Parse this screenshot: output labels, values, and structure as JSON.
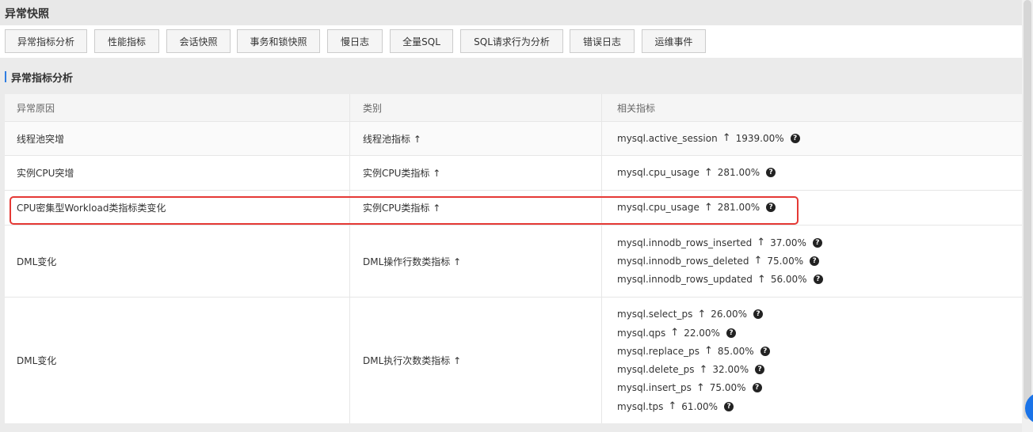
{
  "panel": {
    "title": "异常快照"
  },
  "tabs": [
    {
      "label": "异常指标分析"
    },
    {
      "label": "性能指标"
    },
    {
      "label": "会话快照"
    },
    {
      "label": "事务和锁快照"
    },
    {
      "label": "慢日志"
    },
    {
      "label": "全量SQL"
    },
    {
      "label": "SQL请求行为分析"
    },
    {
      "label": "错误日志"
    },
    {
      "label": "运维事件"
    }
  ],
  "section": {
    "title": "异常指标分析"
  },
  "table": {
    "columns": [
      "异常原因",
      "类别",
      "相关指标"
    ],
    "arrow": "↑",
    "rows": [
      {
        "reason": "线程池突增",
        "category": "线程池指标 ↑",
        "metrics": [
          {
            "name": "mysql.active_session",
            "value": "1939.00%"
          }
        ]
      },
      {
        "reason": "实例CPU突增",
        "category": "实例CPU类指标 ↑",
        "metrics": [
          {
            "name": "mysql.cpu_usage",
            "value": "281.00%"
          }
        ]
      },
      {
        "reason": "CPU密集型Workload类指标类变化",
        "category": "实例CPU类指标 ↑",
        "metrics": [
          {
            "name": "mysql.cpu_usage",
            "value": "281.00%"
          }
        ]
      },
      {
        "reason": "DML变化",
        "category": "DML操作行数类指标 ↑",
        "metrics": [
          {
            "name": "mysql.innodb_rows_inserted",
            "value": "37.00%"
          },
          {
            "name": "mysql.innodb_rows_deleted",
            "value": "75.00%"
          },
          {
            "name": "mysql.innodb_rows_updated",
            "value": "56.00%"
          }
        ]
      },
      {
        "reason": "DML变化",
        "category": "DML执行次数类指标 ↑",
        "metrics": [
          {
            "name": "mysql.select_ps",
            "value": "26.00%"
          },
          {
            "name": "mysql.qps",
            "value": "22.00%"
          },
          {
            "name": "mysql.replace_ps",
            "value": "85.00%"
          },
          {
            "name": "mysql.delete_ps",
            "value": "32.00%"
          },
          {
            "name": "mysql.insert_ps",
            "value": "75.00%"
          },
          {
            "name": "mysql.tps",
            "value": "61.00%"
          }
        ]
      }
    ]
  },
  "icons": {
    "help": "question-circle-icon",
    "up": "arrow-up-icon"
  },
  "colors": {
    "accent": "#2f7de1",
    "highlight": "#e53935"
  }
}
